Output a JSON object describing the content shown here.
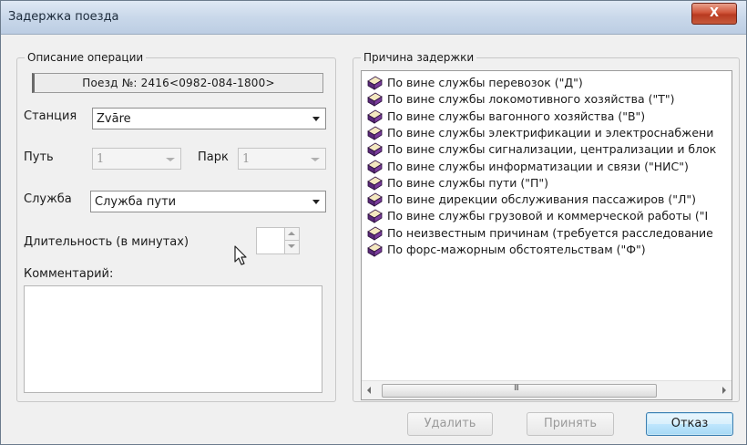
{
  "window": {
    "title": "Задержка поезда",
    "close_label": "X"
  },
  "left_panel": {
    "legend": "Описание операции",
    "train_info": "Поезд №: 2416<0982-084-1800>",
    "station_label": "Станция",
    "station_value": "Zvāre",
    "track_label": "Путь",
    "track_value": "1",
    "park_label": "Парк",
    "park_value": "1",
    "service_label": "Служба",
    "service_value": "Служба пути",
    "duration_label": "Длительность (в минутах)",
    "duration_value": "",
    "comment_label": "Комментарий:",
    "comment_value": ""
  },
  "right_panel": {
    "legend": "Причина задержки",
    "items": [
      {
        "label": "По вине службы перевозок (\"Д\")"
      },
      {
        "label": "По вине службы локомотивного хозяйства (\"Т\")"
      },
      {
        "label": "По вине службы вагонного хозяйства (\"В\")"
      },
      {
        "label": "По вине службы электрификации и электроснабжени"
      },
      {
        "label": "По вине службы сигнализации, централизации и блок"
      },
      {
        "label": "По вине службы информатизации и связи (\"НИС\")"
      },
      {
        "label": "По вине службы пути (\"П\")"
      },
      {
        "label": "По вине дирекции обслуживания пассажиров (\"Л\")"
      },
      {
        "label": "По вине службы грузовой и коммерческой работы (\"І"
      },
      {
        "label": "По неизвестным причинам (требуется расследование"
      },
      {
        "label": "По форс-мажорным обстоятельствам (\"Ф\")"
      }
    ],
    "scroll_grip": "III",
    "book_icon": "book-icon",
    "colors": {
      "book_cover": "#5a2a7a",
      "book_pages": "#f4e8c0"
    }
  },
  "buttons": {
    "delete_label": "Удалить",
    "accept_label": "Принять",
    "cancel_label": "Отказ"
  }
}
